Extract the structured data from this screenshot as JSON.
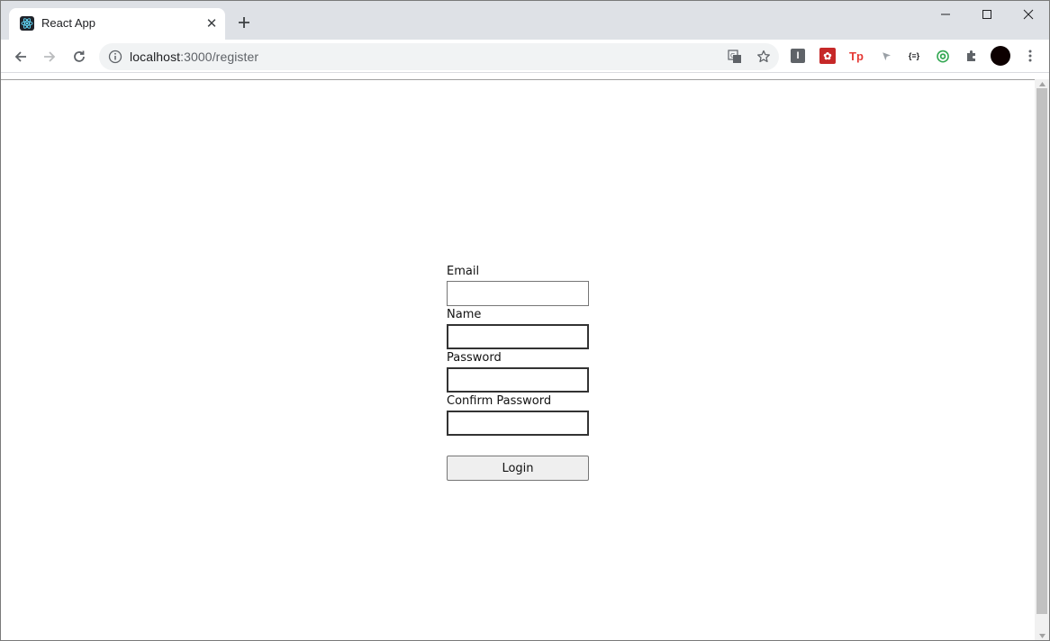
{
  "browser": {
    "tab": {
      "title": "React App",
      "favicon": "react-logo-icon",
      "close_glyph": "✕"
    },
    "new_tab_glyph": "+",
    "window_controls": [
      "minimize-icon",
      "maximize-icon",
      "close-icon"
    ],
    "url": {
      "host": "localhost",
      "path": ":3000/register"
    },
    "extensions": [
      {
        "name": "ext-i-icon",
        "glyph": "I",
        "color": "#5f6368"
      },
      {
        "name": "ext-red-icon",
        "glyph": "✿",
        "color": "#d93025"
      },
      {
        "name": "ext-tp-icon",
        "glyph": "Tp",
        "color": "#e53935"
      },
      {
        "name": "ext-cursor-icon",
        "glyph": "➤",
        "color": "#9aa0a6"
      },
      {
        "name": "ext-json-icon",
        "glyph": "{≡}",
        "color": "#202124"
      },
      {
        "name": "ext-ring-icon",
        "glyph": "◎",
        "color": "#34a853"
      }
    ]
  },
  "form": {
    "email_label": "Email",
    "email_value": "",
    "name_label": "Name",
    "name_value": "",
    "password_label": "Password",
    "password_value": "",
    "confirm_label": "Confirm Password",
    "confirm_value": "",
    "submit_label": "Login"
  }
}
